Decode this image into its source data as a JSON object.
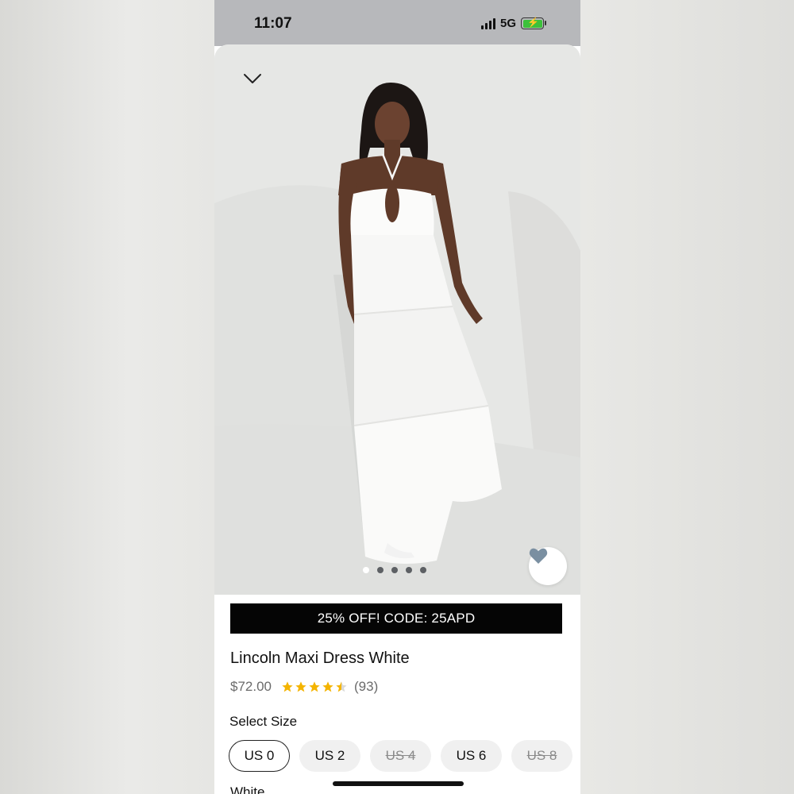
{
  "status_bar": {
    "time": "11:07",
    "network": "5G"
  },
  "product": {
    "promo": "25% OFF! CODE: 25APD",
    "title": "Lincoln Maxi Dress White",
    "price": "$72.00",
    "rating": 4.5,
    "review_count": "(93)",
    "image_count": 5,
    "active_image_index": 0,
    "hero_image": "woman-in-white-halter-maxi-dress",
    "favorited": true
  },
  "size_section": {
    "label": "Select Size",
    "sizes": [
      {
        "label": "US 0",
        "selected": true,
        "available": true
      },
      {
        "label": "US 2",
        "selected": false,
        "available": true
      },
      {
        "label": "US 4",
        "selected": false,
        "available": false
      },
      {
        "label": "US 6",
        "selected": false,
        "available": true
      },
      {
        "label": "US 8",
        "selected": false,
        "available": false
      }
    ]
  },
  "color_section": {
    "label": "White"
  },
  "colors": {
    "promo_bg": "#050505",
    "star": "#f4b400",
    "heart": "#7a8fa1",
    "battery": "#3cc13b"
  },
  "icons": {
    "collapse": "chevron-down-icon",
    "favorite": "heart-icon",
    "signal": "signal-icon",
    "battery": "battery-icon"
  }
}
